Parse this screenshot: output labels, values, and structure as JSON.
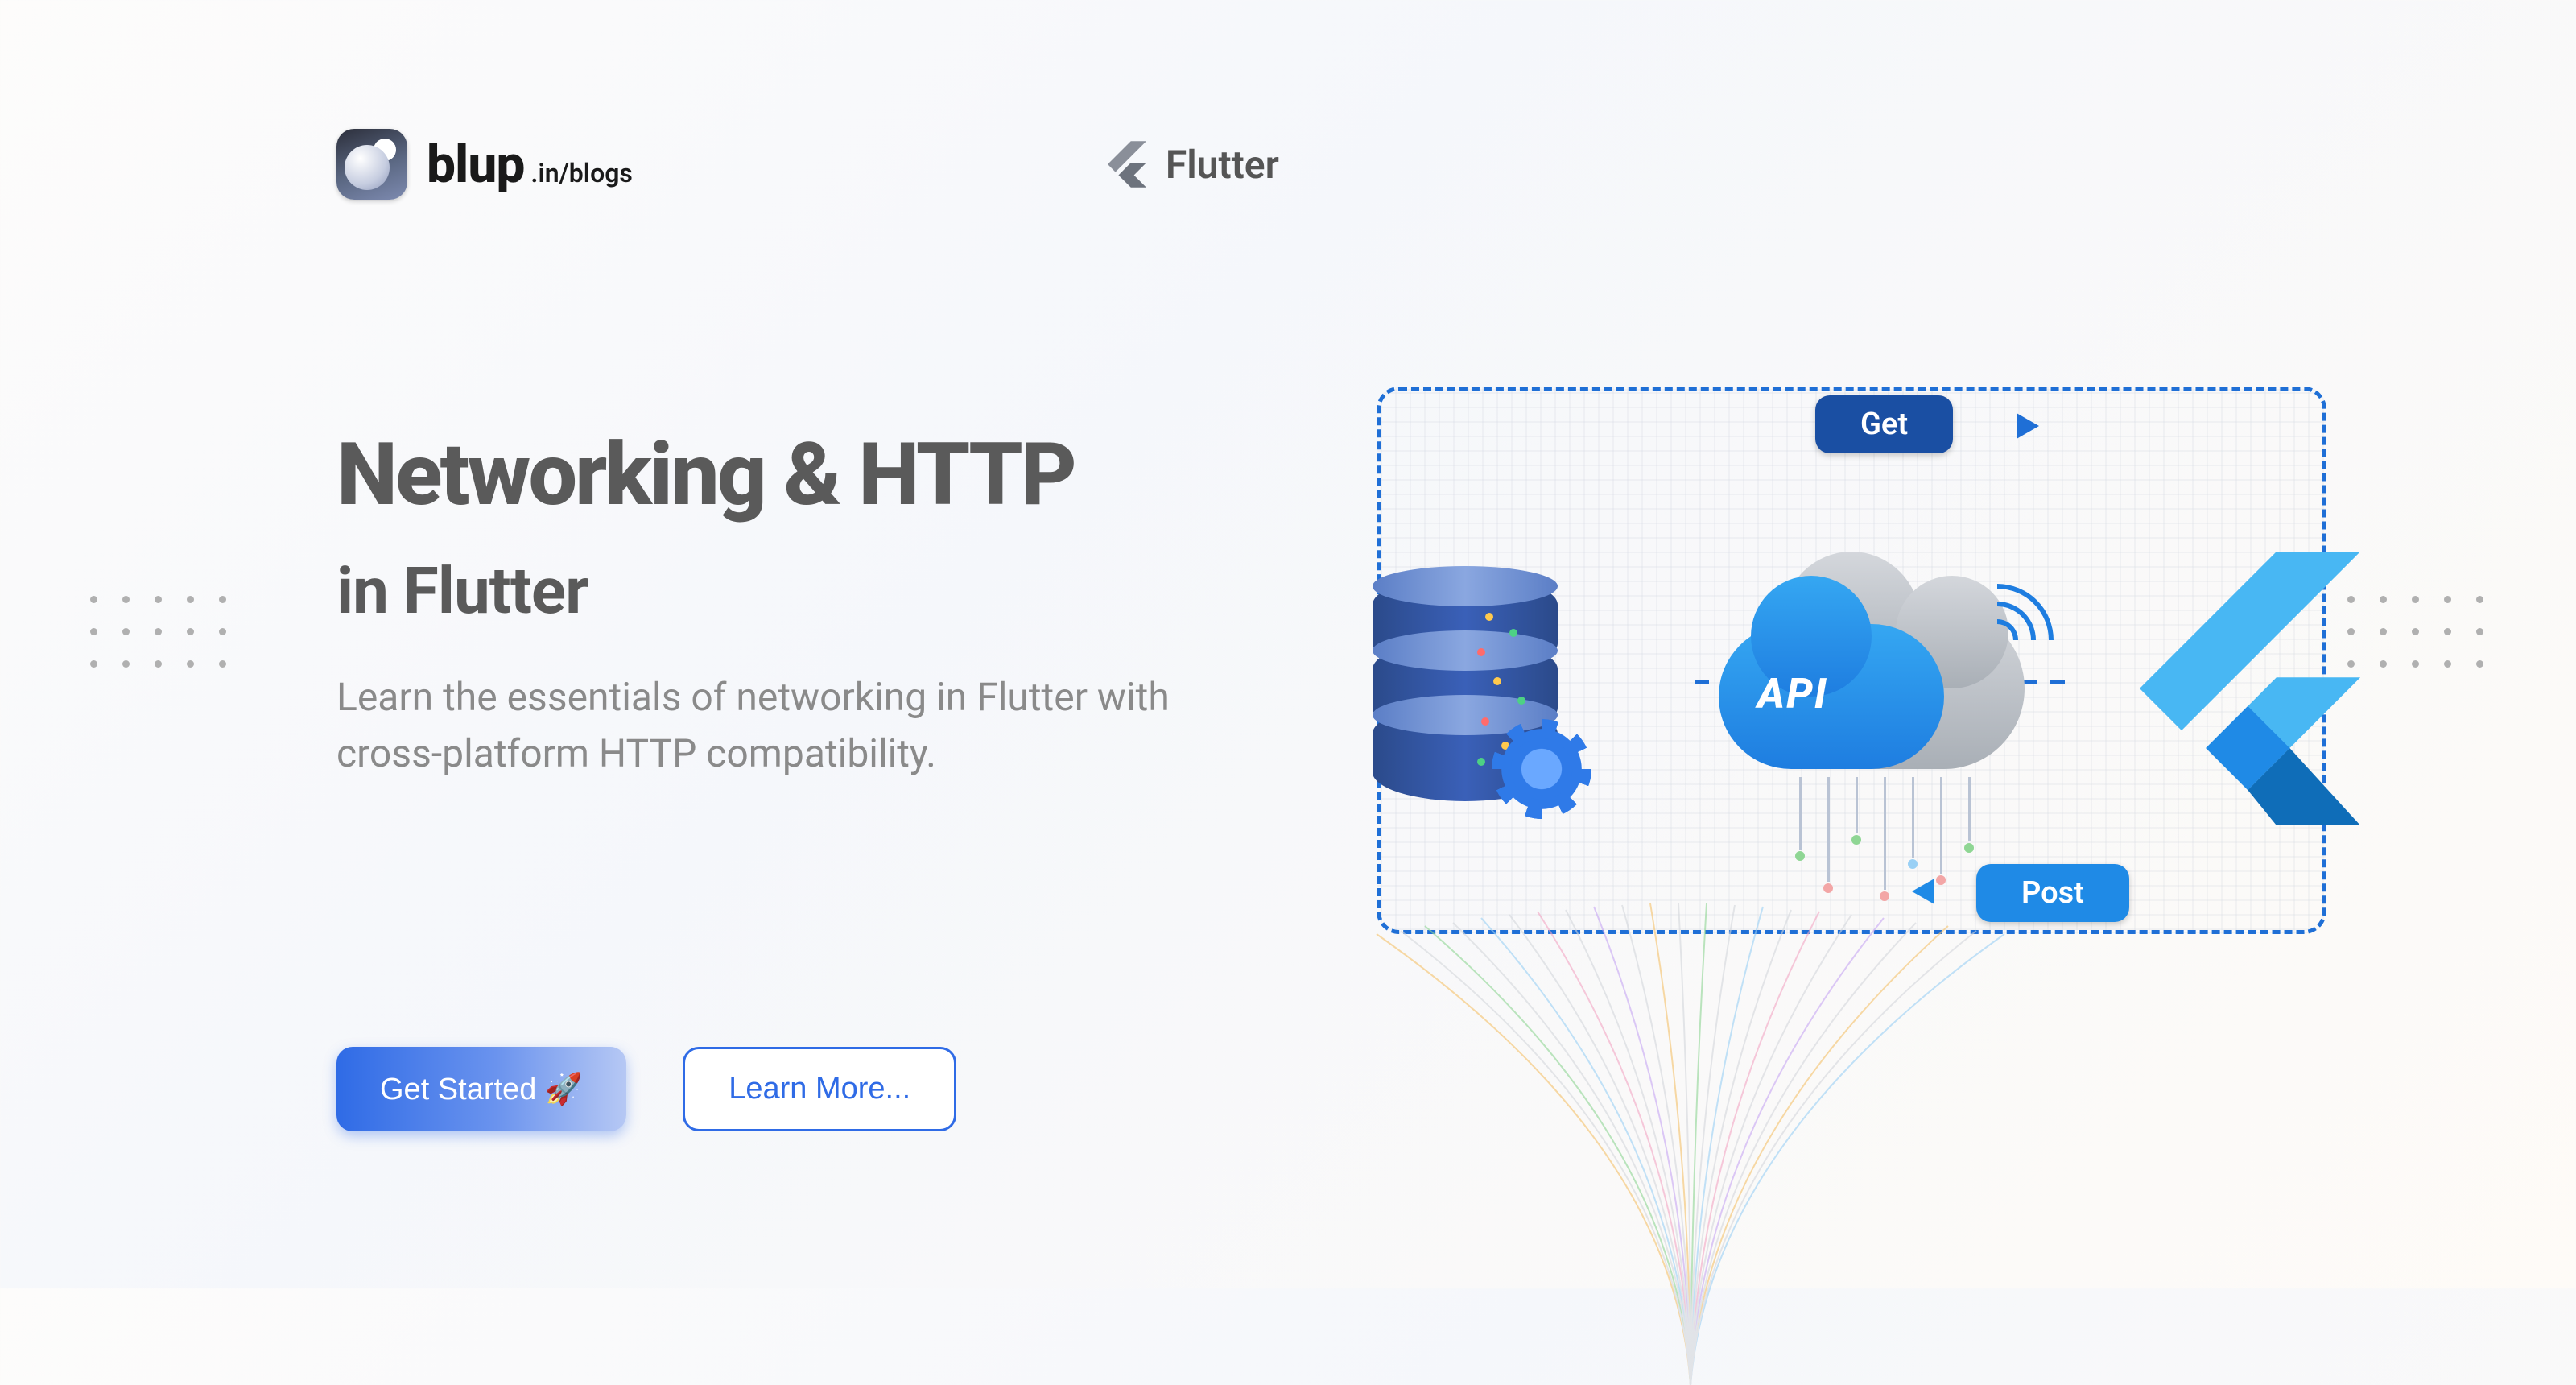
{
  "brand": {
    "name": "blup",
    "path": ".in/blogs"
  },
  "header": {
    "flutter_label": "Flutter"
  },
  "hero": {
    "title_line1": "Networking & HTTP",
    "title_line2": "in Flutter",
    "subtitle": "Learn the essentials of networking in Flutter with cross-platform HTTP compatibility."
  },
  "cta": {
    "primary": "Get Started 🚀",
    "secondary": "Learn More..."
  },
  "diagram": {
    "get_label": "Get",
    "post_label": "Post",
    "api_label": "API"
  },
  "colors": {
    "primary_blue": "#2f6be6",
    "flutter_blue": "#1f8ae6",
    "dark_blue": "#1a4fa3",
    "text_gray": "#5a5a5a"
  }
}
